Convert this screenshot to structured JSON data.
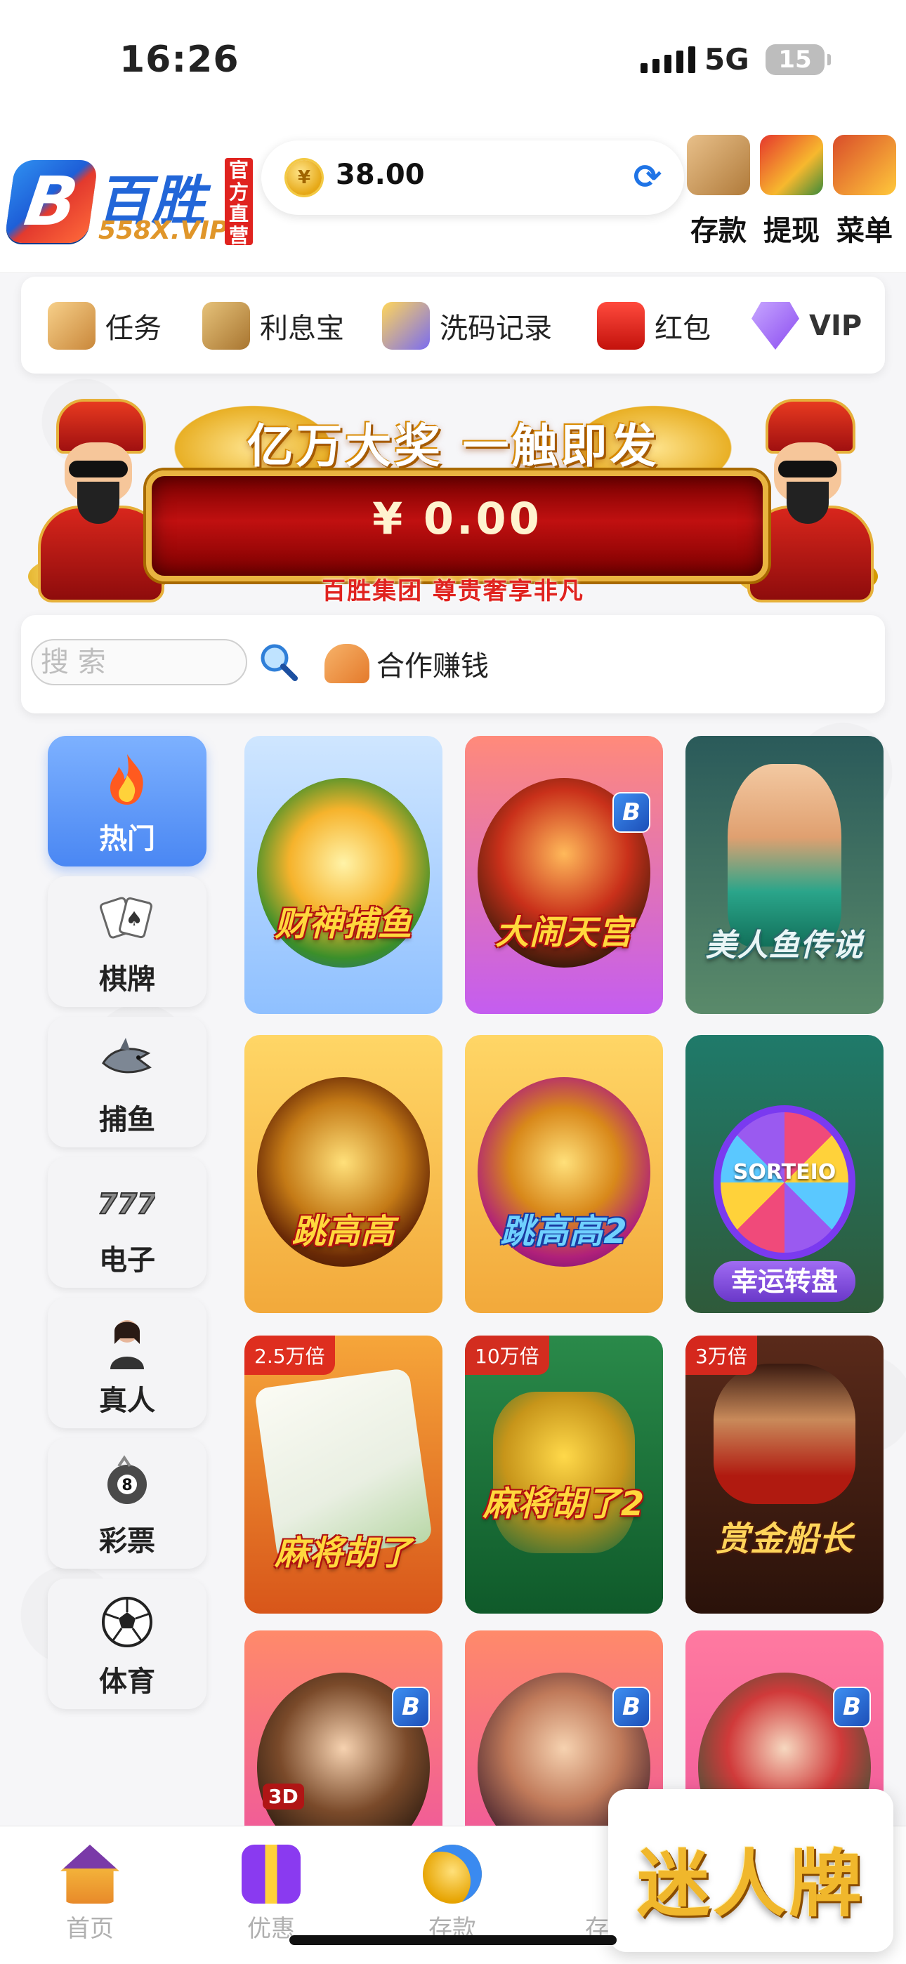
{
  "status": {
    "time": "16:26",
    "network": "5G",
    "battery": "15"
  },
  "header": {
    "logo_text": "百胜",
    "logo_sub": "558X.VIP",
    "logo_tag": "官方直营",
    "balance": "38.00",
    "buttons": [
      {
        "label": "存款",
        "icon": "wallet-icon"
      },
      {
        "label": "提现",
        "icon": "atm-icon"
      },
      {
        "label": "菜单",
        "icon": "treasure-chest-icon"
      }
    ]
  },
  "quick_nav": [
    {
      "label": "任务",
      "icon": "task-icon"
    },
    {
      "label": "利息宝",
      "icon": "money-bag-icon"
    },
    {
      "label": "洗码记录",
      "icon": "coins-icon"
    },
    {
      "label": "红包",
      "icon": "red-envelope-icon"
    },
    {
      "label": "VIP",
      "icon": "vip-diamond-icon"
    }
  ],
  "banner": {
    "title": "亿万大奖  一触即发",
    "jackpot": "¥ 0.00",
    "slogan": "百胜集团 尊贵奢享非凡"
  },
  "search": {
    "placeholder": "搜 索",
    "coop_label": "合作赚钱"
  },
  "categories": [
    {
      "label": "热门",
      "icon": "fire-icon",
      "active": true
    },
    {
      "label": "棋牌",
      "icon": "cards-icon"
    },
    {
      "label": "捕鱼",
      "icon": "shark-icon"
    },
    {
      "label": "电子",
      "icon": "slot-777-icon"
    },
    {
      "label": "真人",
      "icon": "dealer-icon"
    },
    {
      "label": "彩票",
      "icon": "lottery-ball-icon"
    },
    {
      "label": "体育",
      "icon": "soccer-ball-icon"
    }
  ],
  "games": [
    {
      "name": "财神捕鱼",
      "badge": "",
      "multiplier": ""
    },
    {
      "name": "大闹天宫",
      "badge": "B",
      "multiplier": ""
    },
    {
      "name": "美人鱼传说",
      "badge": "",
      "multiplier": ""
    },
    {
      "name": "跳高高",
      "badge": "",
      "multiplier": ""
    },
    {
      "name": "跳高高2",
      "badge": "",
      "multiplier": ""
    },
    {
      "name": "幸运转盘",
      "badge": "",
      "multiplier": "",
      "wheel_text": "SORTEIO"
    },
    {
      "name": "麻将胡了",
      "badge": "",
      "multiplier": "2.5万倍"
    },
    {
      "name": "麻将胡了2",
      "badge": "",
      "multiplier": "10万倍"
    },
    {
      "name": "赏金船长",
      "badge": "",
      "multiplier": "3万倍"
    },
    {
      "name": "",
      "badge": "B",
      "multiplier": "",
      "tag": "3D"
    },
    {
      "name": "",
      "badge": "B",
      "multiplier": ""
    },
    {
      "name": "",
      "badge": "B",
      "multiplier": ""
    }
  ],
  "tabbar": [
    {
      "label": "首页",
      "icon": "home-icon"
    },
    {
      "label": "优惠",
      "icon": "gift-icon"
    },
    {
      "label": "存款",
      "icon": "deposit-coin-icon"
    },
    {
      "label": "存",
      "icon": "partial-icon"
    }
  ],
  "popup": {
    "text": "迷人牌"
  },
  "colors": {
    "accent": "#4a87f3",
    "red": "#e0231f",
    "gold": "#f0b72c"
  }
}
